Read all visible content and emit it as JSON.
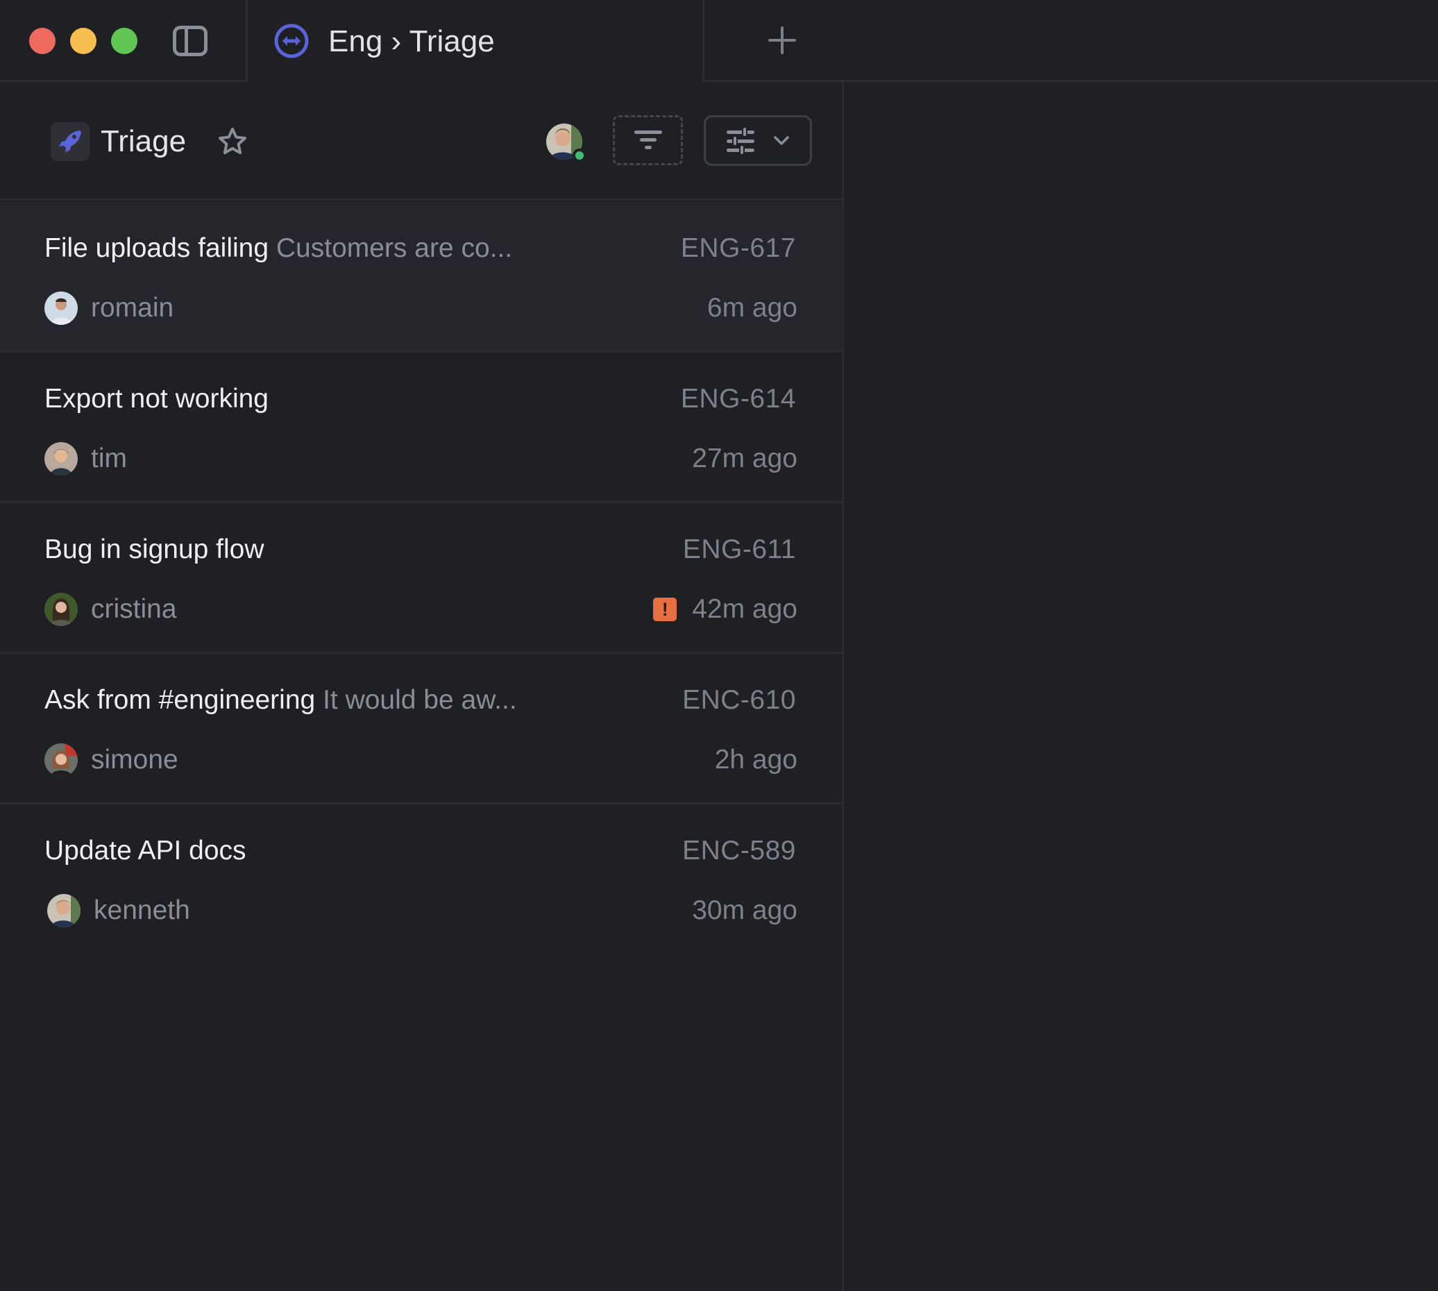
{
  "window": {
    "controls": [
      "close",
      "minimize",
      "maximize"
    ],
    "sidebar_toggle_icon": "sidebar-panel-icon"
  },
  "tabs": [
    {
      "label": "Eng › Triage",
      "icon": "triage-arrows-icon",
      "active": true
    }
  ],
  "new_tab_icon": "plus-icon",
  "view": {
    "title": "Triage",
    "icon": "rocket-icon",
    "favorite_icon": "star-outline-icon",
    "current_user_online": true,
    "filter_icon": "filter-lines-icon",
    "display_options_icon": "sliders-icon",
    "display_options_chevron": "chevron-down-icon"
  },
  "colors": {
    "accent": "#5b63d9",
    "background": "#1f2024",
    "selected_row": "#25262b",
    "urgent": "#e9703e",
    "presence_online": "#3fbf74"
  },
  "issues": [
    {
      "title": "File uploads failing",
      "description": "Customers are co...",
      "id": "ENG-617",
      "assignee": "romain",
      "time": "6m ago",
      "urgent": false,
      "selected": true,
      "urgent_label": ""
    },
    {
      "title": "Export not working",
      "description": "",
      "id": "ENG-614",
      "assignee": "tim",
      "time": "27m ago",
      "urgent": false,
      "selected": false,
      "urgent_label": ""
    },
    {
      "title": "Bug in signup flow",
      "description": "",
      "id": "ENG-611",
      "assignee": "cristina",
      "time": "42m ago",
      "urgent": true,
      "selected": false,
      "urgent_label": "!"
    },
    {
      "title": "Ask from #engineering",
      "description": "It would be aw...",
      "id": "ENC-610",
      "assignee": "simone",
      "time": "2h ago",
      "urgent": false,
      "selected": false,
      "urgent_label": ""
    },
    {
      "title": "Update API docs",
      "description": "",
      "id": "ENC-589",
      "assignee": "kenneth",
      "time": "30m ago",
      "urgent": false,
      "selected": false,
      "urgent_label": ""
    }
  ]
}
